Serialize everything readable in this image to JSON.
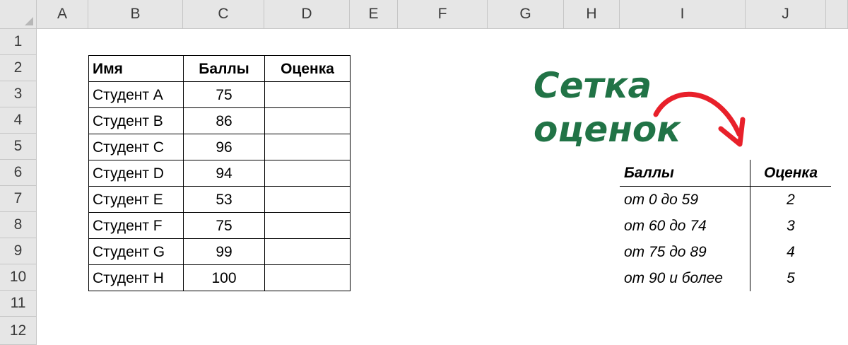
{
  "columns": [
    "A",
    "B",
    "C",
    "D",
    "E",
    "F",
    "G",
    "H",
    "I",
    "J"
  ],
  "rows": [
    "1",
    "2",
    "3",
    "4",
    "5",
    "6",
    "7",
    "8",
    "9",
    "10",
    "11",
    "12"
  ],
  "main_table": {
    "headers": {
      "name": "Имя",
      "score": "Баллы",
      "grade": "Оценка"
    },
    "rows": [
      {
        "name": "Студент A",
        "score": "75",
        "grade": ""
      },
      {
        "name": "Студент B",
        "score": "86",
        "grade": ""
      },
      {
        "name": "Студент C",
        "score": "96",
        "grade": ""
      },
      {
        "name": "Студент D",
        "score": "94",
        "grade": ""
      },
      {
        "name": "Студент E",
        "score": "53",
        "grade": ""
      },
      {
        "name": "Студент F",
        "score": "75",
        "grade": ""
      },
      {
        "name": "Студент G",
        "score": "99",
        "grade": ""
      },
      {
        "name": "Студент H",
        "score": "100",
        "grade": ""
      }
    ]
  },
  "grading": {
    "title_line1": "Сетка",
    "title_line2": "оценок",
    "headers": {
      "score": "Баллы",
      "grade": "Оценка"
    },
    "rows": [
      {
        "score": "от 0 до 59",
        "grade": "2"
      },
      {
        "score": "от 60 до 74",
        "grade": "3"
      },
      {
        "score": "от 75 до 89",
        "grade": "4"
      },
      {
        "score": "от 90 и более",
        "grade": "5"
      }
    ]
  },
  "colors": {
    "title": "#217346",
    "arrow": "#e8202a",
    "header_bg": "#e6e6e6"
  }
}
